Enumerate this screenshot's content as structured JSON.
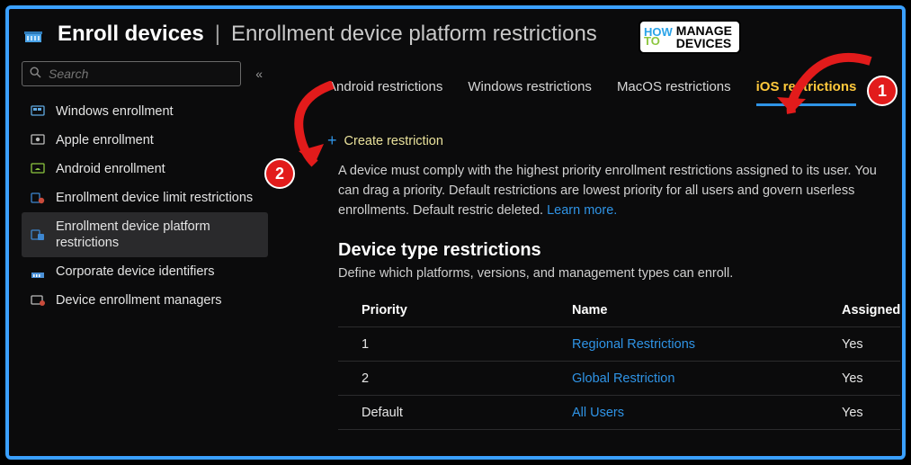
{
  "header": {
    "icon": "building-icon",
    "title": "Enroll devices",
    "subtitle": "Enrollment device platform restrictions"
  },
  "logo": {
    "line1": "HOW",
    "line2": "TO",
    "word1": "MANAGE",
    "word2": "DEVICES"
  },
  "search": {
    "placeholder": "Search"
  },
  "sidebar": {
    "items": [
      {
        "label": "Windows enrollment",
        "icon": "windows-screen-icon"
      },
      {
        "label": "Apple enrollment",
        "icon": "apple-screen-icon"
      },
      {
        "label": "Android enrollment",
        "icon": "android-screen-icon"
      },
      {
        "label": "Enrollment device limit restrictions",
        "icon": "device-limit-icon"
      },
      {
        "label": "Enrollment device platform restrictions",
        "icon": "device-platform-icon",
        "active": true
      },
      {
        "label": "Corporate device identifiers",
        "icon": "corporate-id-icon"
      },
      {
        "label": "Device enrollment managers",
        "icon": "managers-icon"
      }
    ]
  },
  "tabs": [
    {
      "label": "Android restrictions"
    },
    {
      "label": "Windows restrictions"
    },
    {
      "label": "MacOS restrictions"
    },
    {
      "label": "iOS restrictions",
      "active": true
    }
  ],
  "createButton": {
    "label": "Create restriction"
  },
  "description": {
    "text": "A device must comply with the highest priority enrollment restrictions assigned to its user. You can drag a priority. Default restrictions are lowest priority for all users and govern userless enrollments. Default restric deleted. ",
    "link": "Learn more."
  },
  "section": {
    "title": "Device type restrictions",
    "sub": "Define which platforms, versions, and management types can enroll."
  },
  "table": {
    "headers": {
      "c1": "Priority",
      "c2": "Name",
      "c3": "Assigned"
    },
    "rows": [
      {
        "c1": "1",
        "c2": "Regional Restrictions",
        "c3": "Yes"
      },
      {
        "c1": "2",
        "c2": "Global Restriction",
        "c3": "Yes"
      },
      {
        "c1": "Default",
        "c2": "All Users",
        "c3": "Yes"
      }
    ]
  },
  "annotations": {
    "b1": "1",
    "b2": "2"
  }
}
